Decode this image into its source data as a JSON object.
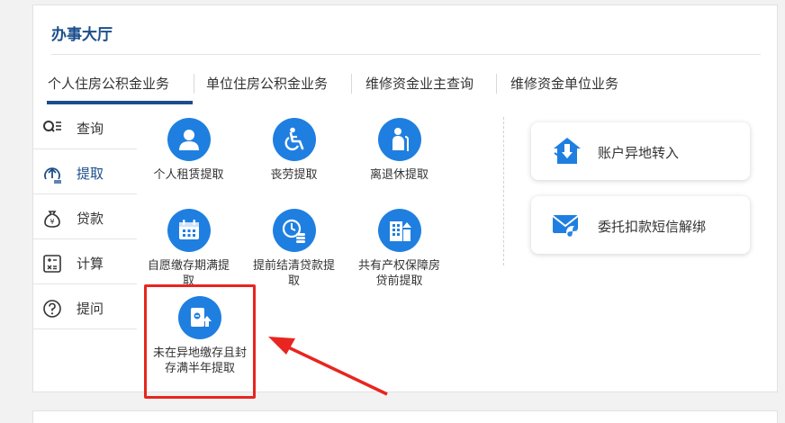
{
  "panel": {
    "title": "办事大厅"
  },
  "tabs": [
    {
      "label": "个人住房公积金业务",
      "active": true
    },
    {
      "label": "单位住房公积金业务",
      "active": false
    },
    {
      "label": "维修资金业主查询",
      "active": false
    },
    {
      "label": "维修资金单位业务",
      "active": false
    }
  ],
  "sidebar": {
    "items": [
      {
        "label": "查询",
        "icon": "search-list-icon"
      },
      {
        "label": "提取",
        "icon": "withdraw-icon",
        "active": true
      },
      {
        "label": "贷款",
        "icon": "money-bag-icon"
      },
      {
        "label": "计算",
        "icon": "calculator-icon"
      },
      {
        "label": "提问",
        "icon": "question-icon"
      }
    ]
  },
  "services": [
    {
      "label": "个人租赁提取",
      "icon": "person-icon"
    },
    {
      "label": "丧劳提取",
      "icon": "wheelchair-icon"
    },
    {
      "label": "离退休提取",
      "icon": "elder-icon"
    },
    {
      "label": "自愿缴存期满提取",
      "icon": "calendar-icon"
    },
    {
      "label": "提前结清贷款提取",
      "icon": "clock-coins-icon"
    },
    {
      "label": "共有产权保障房贷前提取",
      "icon": "building-icon"
    },
    {
      "label": "未在异地缴存且封存满半年提取",
      "icon": "document-upload-icon"
    }
  ],
  "cards": [
    {
      "label": "账户异地转入",
      "icon": "transfer-in-icon"
    },
    {
      "label": "委托扣款短信解绑",
      "icon": "envelope-unlink-icon"
    }
  ],
  "colors": {
    "primary": "#1a4e8c",
    "icon_blue": "#1f7fe0",
    "highlight_red": "#e8251f"
  }
}
